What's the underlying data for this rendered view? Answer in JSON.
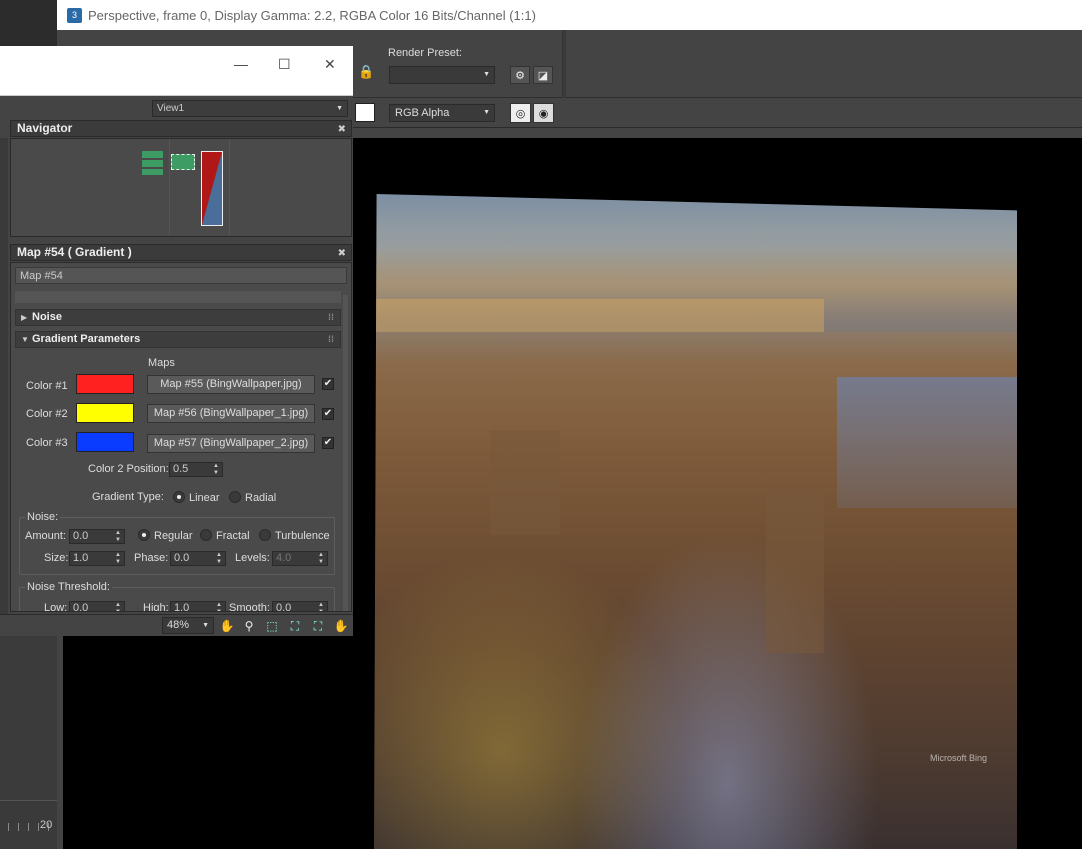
{
  "frame_window": {
    "title": "Perspective, frame 0, Display Gamma: 2.2, RGBA Color 16 Bits/Channel (1:1)",
    "app_icon_text": "3",
    "render_preset_label": "Render Preset:",
    "render_preset_value": "",
    "channel_select": "RGB Alpha"
  },
  "material_editor": {
    "view_select": "View1",
    "navigator_title": "Navigator",
    "map_panel_title": "Map #54  ( Gradient )",
    "map_name": "Map #54",
    "rollouts": {
      "noise": "Noise",
      "gradient_params": "Gradient Parameters"
    },
    "maps_header": "Maps",
    "colors": [
      {
        "label": "Color #1",
        "swatch": "#ff2020",
        "map": "Map #55 (BingWallpaper.jpg)",
        "checked": "✔"
      },
      {
        "label": "Color #2",
        "swatch": "#ffff00",
        "map": "Map #56 (BingWallpaper_1.jpg)",
        "checked": "✔"
      },
      {
        "label": "Color #3",
        "swatch": "#0a3cff",
        "map": "Map #57 (BingWallpaper_2.jpg)",
        "checked": "✔"
      }
    ],
    "color2_position_label": "Color 2 Position:",
    "color2_position": "0.5",
    "gradient_type_label": "Gradient Type:",
    "gradient_type_options": [
      "Linear",
      "Radial"
    ],
    "gradient_type_selected": "Linear",
    "noise_group": {
      "label": "Noise:",
      "amount_label": "Amount:",
      "amount": "0.0",
      "types": [
        "Regular",
        "Fractal",
        "Turbulence"
      ],
      "type_selected": "Regular",
      "size_label": "Size:",
      "size": "1.0",
      "phase_label": "Phase:",
      "phase": "0.0",
      "levels_label": "Levels:",
      "levels": "4.0"
    },
    "noise_threshold_group": {
      "label": "Noise Threshold:",
      "low_label": "Low:",
      "low": "0.0",
      "high_label": "High:",
      "high": "1.0",
      "smooth_label": "Smooth:",
      "smooth": "0.0"
    },
    "zoom": "48%"
  },
  "rendered_image": {
    "watermark": "Microsoft Bing"
  },
  "ruler": {
    "label": "20"
  }
}
